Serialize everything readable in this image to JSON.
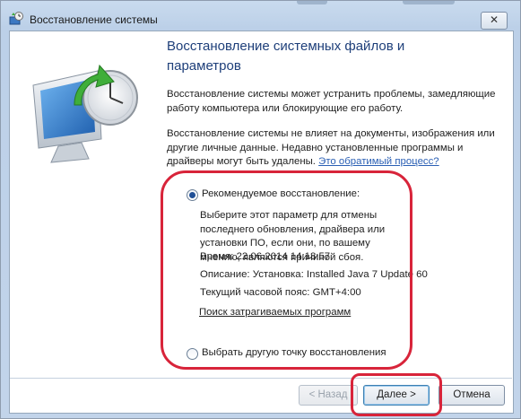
{
  "window": {
    "title": "Восстановление системы"
  },
  "heading": "Восстановление системных файлов и параметров",
  "intro_text": "Восстановление системы может устранить проблемы, замедляющие работу компьютера или блокирующие его работу.",
  "info_text": "Восстановление системы не влияет на документы, изображения или другие личные данные. Недавно установленные программы и драйверы могут быть удалены.",
  "info_link": "Это обратимый процесс?",
  "options": {
    "recommended": {
      "label": "Рекомендуемое восстановление:",
      "checked": true,
      "description": "Выберите этот параметр для отмены последнего обновления, драйвера или установки ПО, если они, по вашему мнению, являются причиной сбоя.",
      "time": "Время: 22.06.2014 14:18:57",
      "descr_line": "Описание: Установка: Installed Java 7 Update 60",
      "timezone": "Текущий часовой пояс: GMT+4:00",
      "scan_link": "Поиск затрагиваемых программ"
    },
    "other": {
      "label": "Выбрать другую точку восстановления",
      "checked": false
    }
  },
  "buttons": {
    "back": "< Назад",
    "next": "Далее >",
    "cancel": "Отмена"
  },
  "icons": {
    "title": "system-restore-icon",
    "close": "close-icon",
    "illustration": "restore-monitor-clock-icon"
  },
  "colors": {
    "annotation": "#d8243a",
    "link": "#2a5fb4",
    "heading": "#1e3f7a"
  }
}
